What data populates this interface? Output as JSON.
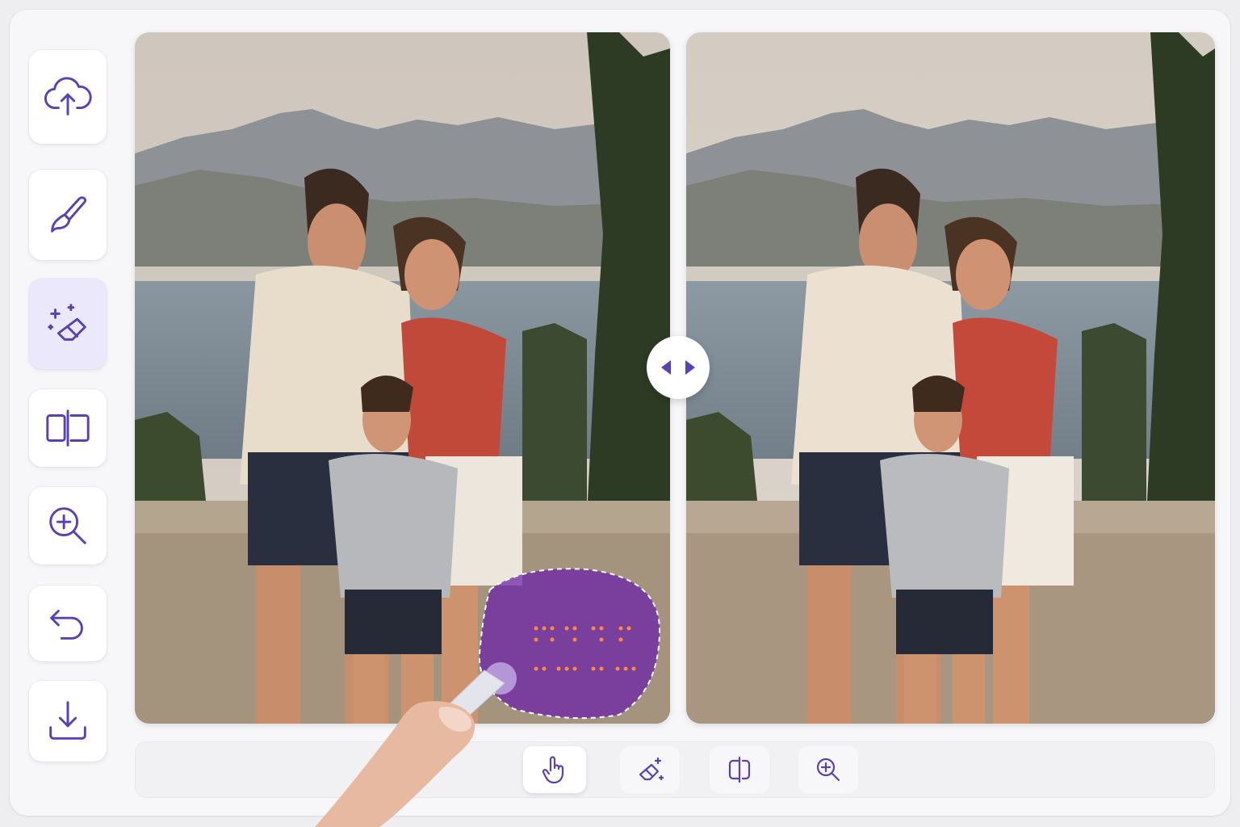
{
  "theme": {
    "accent": "#5b3fb7",
    "active_tool_bg": "#ece8fb",
    "mask_color": "#6a1fa8"
  },
  "sidebar": {
    "items": [
      {
        "icon": "cloud-upload-icon",
        "active": false
      },
      {
        "icon": "brush-icon",
        "active": false
      },
      {
        "icon": "magic-eraser-icon",
        "active": true
      },
      {
        "icon": "compare-split-icon",
        "active": false
      },
      {
        "icon": "zoom-in-icon",
        "active": false
      },
      {
        "icon": "undo-icon",
        "active": false
      },
      {
        "icon": "download-icon",
        "active": false
      }
    ]
  },
  "viewer": {
    "left_pane": "original-photo-with-date-stamp",
    "right_pane": "restored-photo",
    "split_handle_icon": "left-right-arrows-icon",
    "date_stamp_masked": true
  },
  "bottom_toolbar": {
    "items": [
      {
        "icon": "hand-pointer-icon",
        "active": true
      },
      {
        "icon": "magic-eraser-icon",
        "active": false
      },
      {
        "icon": "compare-split-icon",
        "active": false
      },
      {
        "icon": "zoom-in-icon",
        "active": false
      }
    ]
  }
}
